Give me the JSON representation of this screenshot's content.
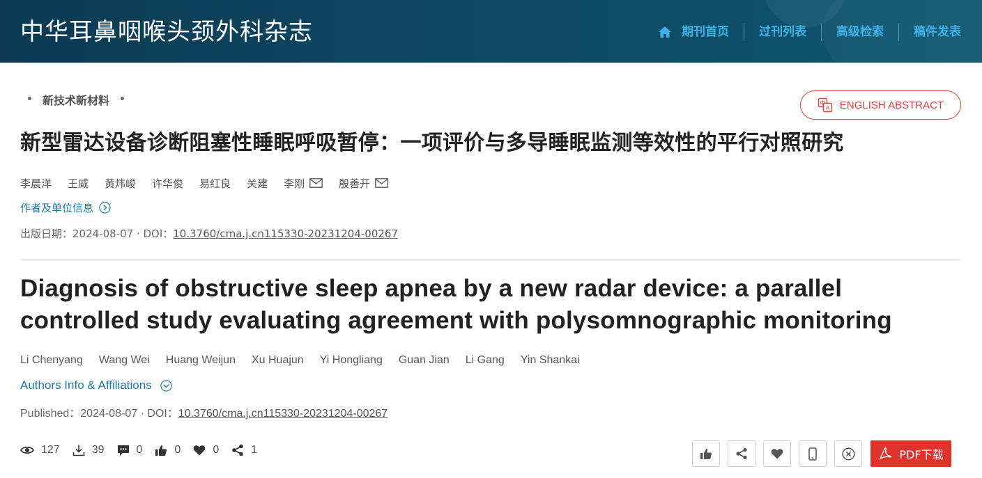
{
  "header": {
    "site_title": "中华耳鼻咽喉头颈外科杂志",
    "nav": [
      {
        "label": "期刊首页",
        "icon": "home-icon"
      },
      {
        "label": "过刊列表"
      },
      {
        "label": "高级检索"
      },
      {
        "label": "稿件发表"
      }
    ]
  },
  "article": {
    "category": "新技术新材料",
    "english_abstract_button": "ENGLISH ABSTRACT",
    "cn_title": "新型雷达设备诊断阻塞性睡眠呼吸暂停：一项评价与多导睡眠监测等效性的平行对照研究",
    "cn_authors": [
      {
        "name": "李晨洋",
        "mail": false
      },
      {
        "name": "王威",
        "mail": false
      },
      {
        "name": "黄炜峻",
        "mail": false
      },
      {
        "name": "许华俊",
        "mail": false
      },
      {
        "name": "易红良",
        "mail": false
      },
      {
        "name": "关建",
        "mail": false
      },
      {
        "name": "李刚",
        "mail": true
      },
      {
        "name": "殷善开",
        "mail": true
      }
    ],
    "cn_affil_link": "作者及单位信息",
    "cn_pub_prefix": "出版日期：2024-08-07 · DOI：",
    "doi": "10.3760/cma.j.cn115330-20231204-00267",
    "en_title": "Diagnosis of obstructive sleep apnea by a new radar device: a parallel controlled study evaluating agreement with polysomnographic monitoring",
    "en_authors": [
      "Li Chenyang",
      "Wang Wei",
      "Huang Weijun",
      "Xu Huajun",
      "Yi Hongliang",
      "Guan Jian",
      "Li Gang",
      "Yin Shankai"
    ],
    "en_affil_link": "Authors Info & Affiliations",
    "en_pub_prefix": "Published：2024-08-07 · DOI："
  },
  "stats": {
    "views": "127",
    "downloads": "39",
    "comments": "0",
    "likes": "0",
    "favorites": "0",
    "shares": "1"
  },
  "actions": {
    "pdf_label": "PDF下载"
  },
  "colors": {
    "header_bg": "#0f4863",
    "nav_accent": "#3eb3e8",
    "link": "#1a7ba8",
    "pdf_red": "#e0332c"
  }
}
